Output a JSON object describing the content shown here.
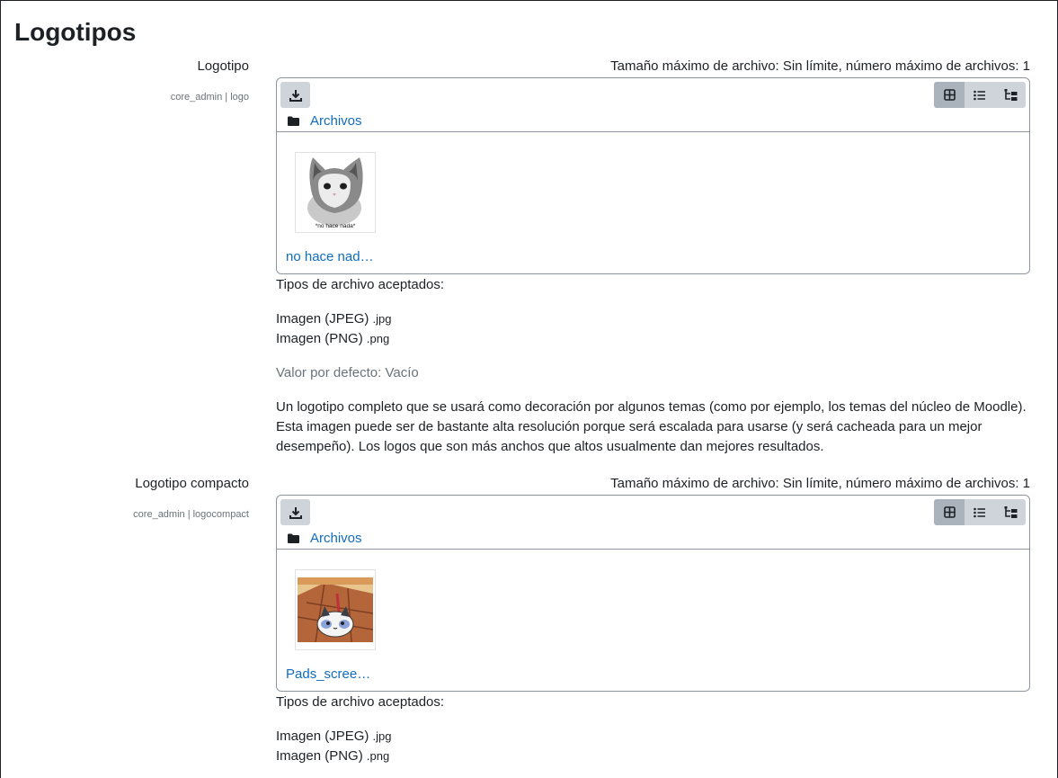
{
  "page": {
    "section_title": "Logotipos"
  },
  "settings": [
    {
      "label": "Logotipo",
      "key": "core_admin | logo",
      "limits": "Tamaño máximo de archivo: Sin límite, número máximo de archivos: 1",
      "folder_link": "Archivos",
      "file_name": "no hace nad…",
      "thumb_caption": "*no hace nada*",
      "accepted_title": "Tipos de archivo aceptados:",
      "types": [
        {
          "name": "Imagen (JPEG)",
          "ext": ".jpg"
        },
        {
          "name": "Imagen (PNG)",
          "ext": ".png"
        }
      ],
      "default_value": "Valor por defecto: Vacío",
      "description": "Un logotipo completo que se usará como decoración por algunos temas (como por ejemplo, los temas del núcleo de Moodle). Esta imagen puede ser de bastante alta resolución porque será escalada para usarse (y será cacheada para un mejor desempeño). Los logos que son más anchos que altos usualmente dan mejores resultados."
    },
    {
      "label": "Logotipo compacto",
      "key": "core_admin | logocompact",
      "limits": "Tamaño máximo de archivo: Sin límite, número máximo de archivos: 1",
      "folder_link": "Archivos",
      "file_name": "Pads_scree…",
      "accepted_title": "Tipos de archivo aceptados:",
      "types": [
        {
          "name": "Imagen (JPEG)",
          "ext": ".jpg"
        },
        {
          "name": "Imagen (PNG)",
          "ext": ".png"
        }
      ]
    }
  ],
  "icons": {
    "download": "download-icon",
    "view_icons": "grid-icon",
    "view_list": "list-icon",
    "view_tree": "tree-icon",
    "folder": "folder-icon"
  },
  "colors": {
    "link": "#0f6cbf",
    "muted": "#6a737b",
    "button": "#ced4da",
    "button_active": "#aab2bb"
  }
}
